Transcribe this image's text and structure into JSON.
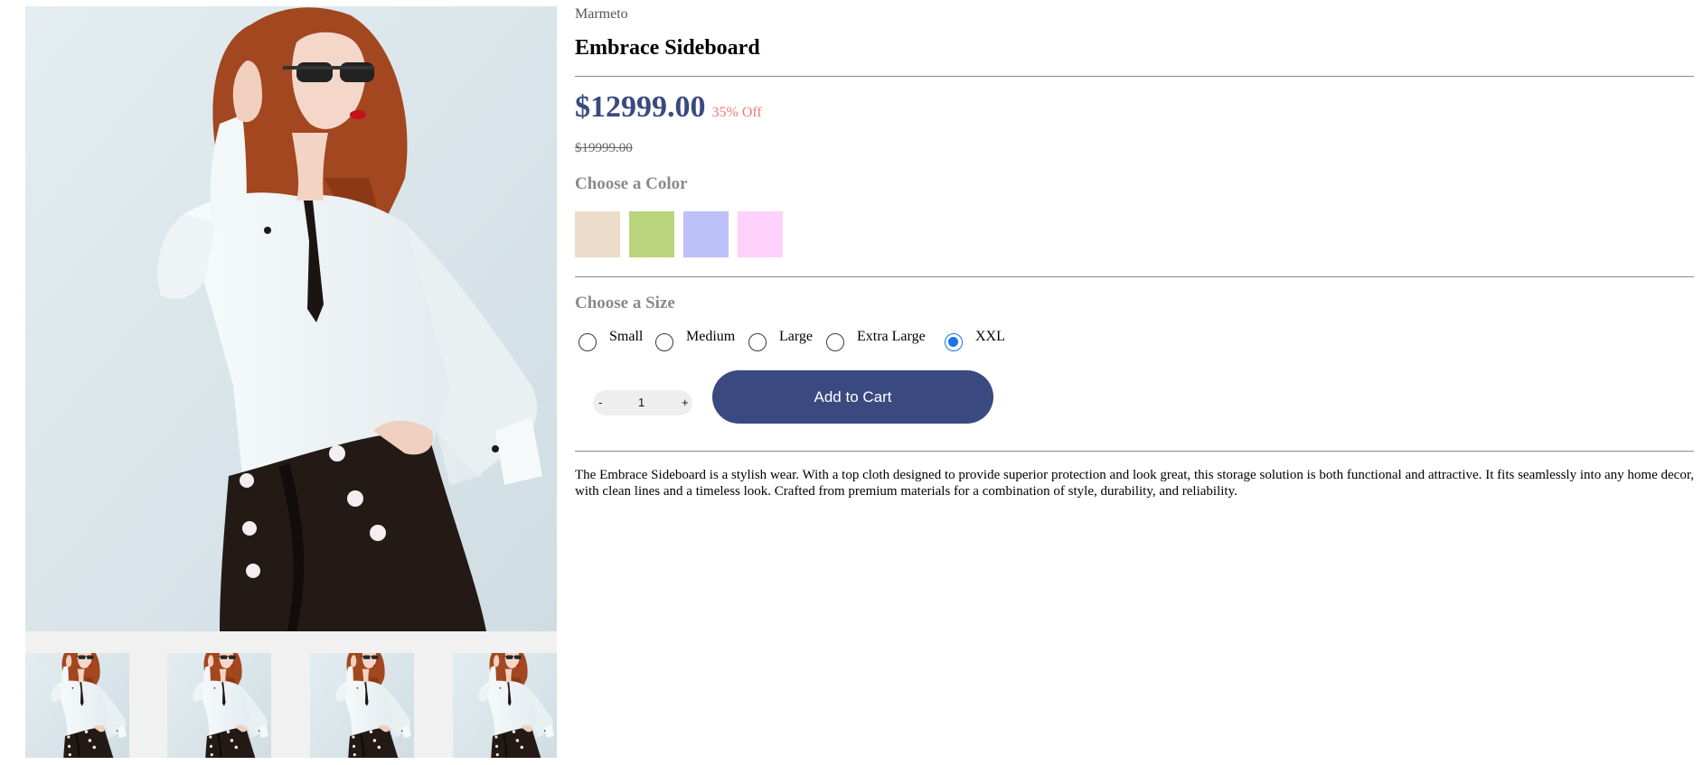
{
  "product": {
    "vendor": "Marmeto",
    "title": "Embrace Sideboard",
    "price": "$12999.00",
    "discount": "35% Off",
    "compare_price": "$19999.00",
    "description": "The Embrace Sideboard is a stylish wear. With a top cloth designed to provide superior protection and look great, this storage solution is both functional and attractive. It fits seamlessly into any home decor, with clean lines and a timeless look. Crafted from premium materials for a combination of style, durability, and reliability."
  },
  "color": {
    "label": "Choose a Color",
    "swatches": [
      "#ecdccb",
      "#bad47c",
      "#bcc1f9",
      "#ffd1fb"
    ]
  },
  "size": {
    "label": "Choose a Size",
    "options": [
      "Small",
      "Medium",
      "Large",
      "Extra Large",
      "XXL"
    ],
    "selected": "XXL"
  },
  "quantity": {
    "minus": "-",
    "value": "1",
    "plus": "+"
  },
  "cart": {
    "button_label": "Add to Cart"
  },
  "colors": {
    "accent": "#3a4a80",
    "discount": "#f07a7a",
    "radio_selected": "#1a73e8"
  },
  "gallery": {
    "main_image": "woman-white-shirt-black-skirt-photo",
    "thumbnails": [
      "product-thumb-photo",
      "product-thumb-photo",
      "product-thumb-photo",
      "product-thumb-photo"
    ]
  }
}
